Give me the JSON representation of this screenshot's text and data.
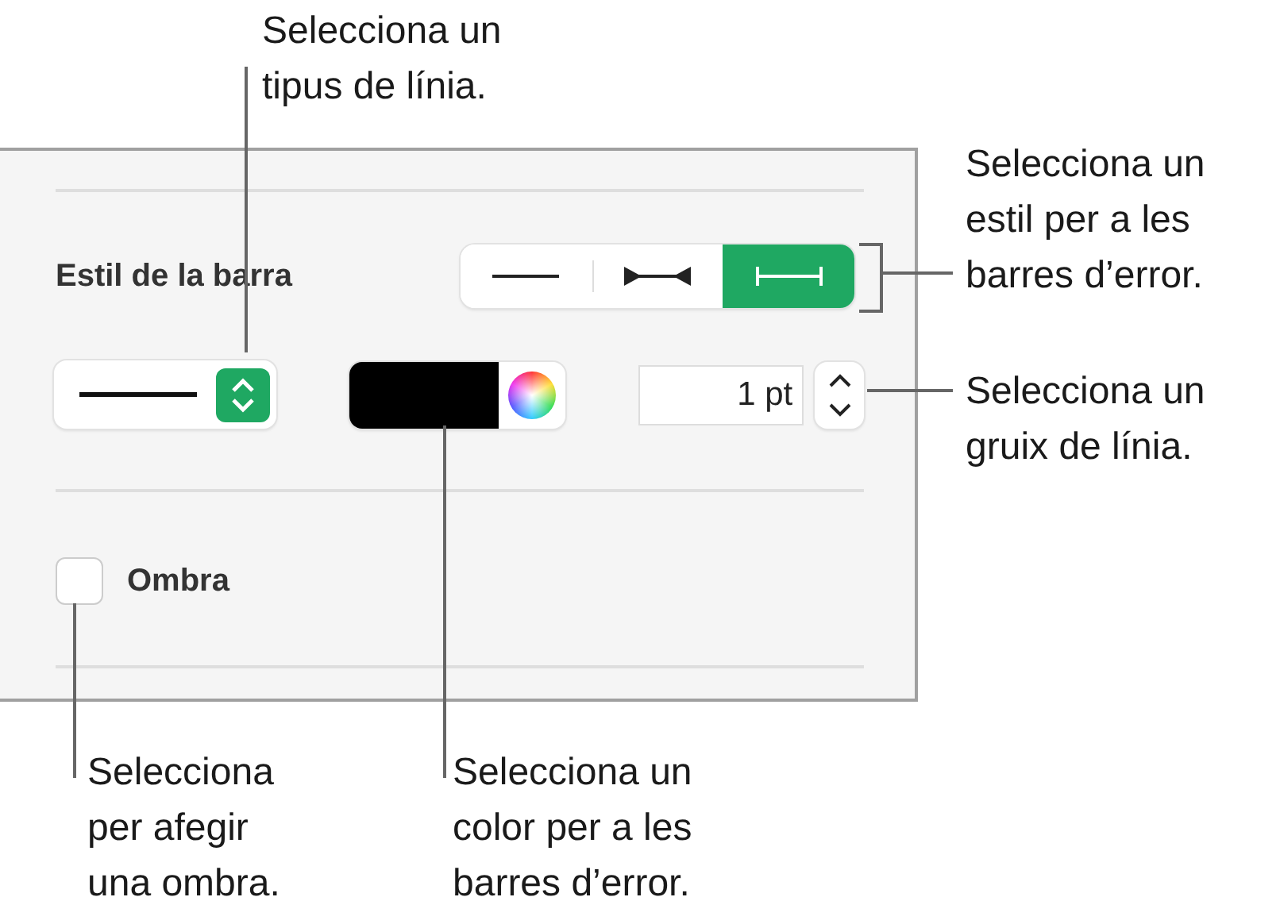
{
  "panel": {
    "bar_style_label": "Estil de la barra",
    "segments": [
      {
        "kind": "plain",
        "selected": false
      },
      {
        "kind": "arrows",
        "selected": false
      },
      {
        "kind": "caps",
        "selected": true
      }
    ],
    "line_style_popup": {
      "kind": "solid"
    },
    "color_well": {
      "color": "#000000"
    },
    "thickness": {
      "value": "1 pt"
    },
    "shadow": {
      "label": "Ombra",
      "checked": false
    }
  },
  "callouts": [
    {
      "lines": [
        "Selecciona un",
        "tipus de línia."
      ]
    },
    {
      "lines": [
        "Selecciona un",
        "estil per a les",
        "barres d’error."
      ]
    },
    {
      "lines": [
        "Selecciona un",
        "gruix de línia."
      ]
    },
    {
      "lines": [
        "Selecciona",
        "per afegir",
        "una ombra."
      ]
    },
    {
      "lines": [
        "Selecciona un",
        "color per a les",
        "barres d’error."
      ]
    }
  ]
}
